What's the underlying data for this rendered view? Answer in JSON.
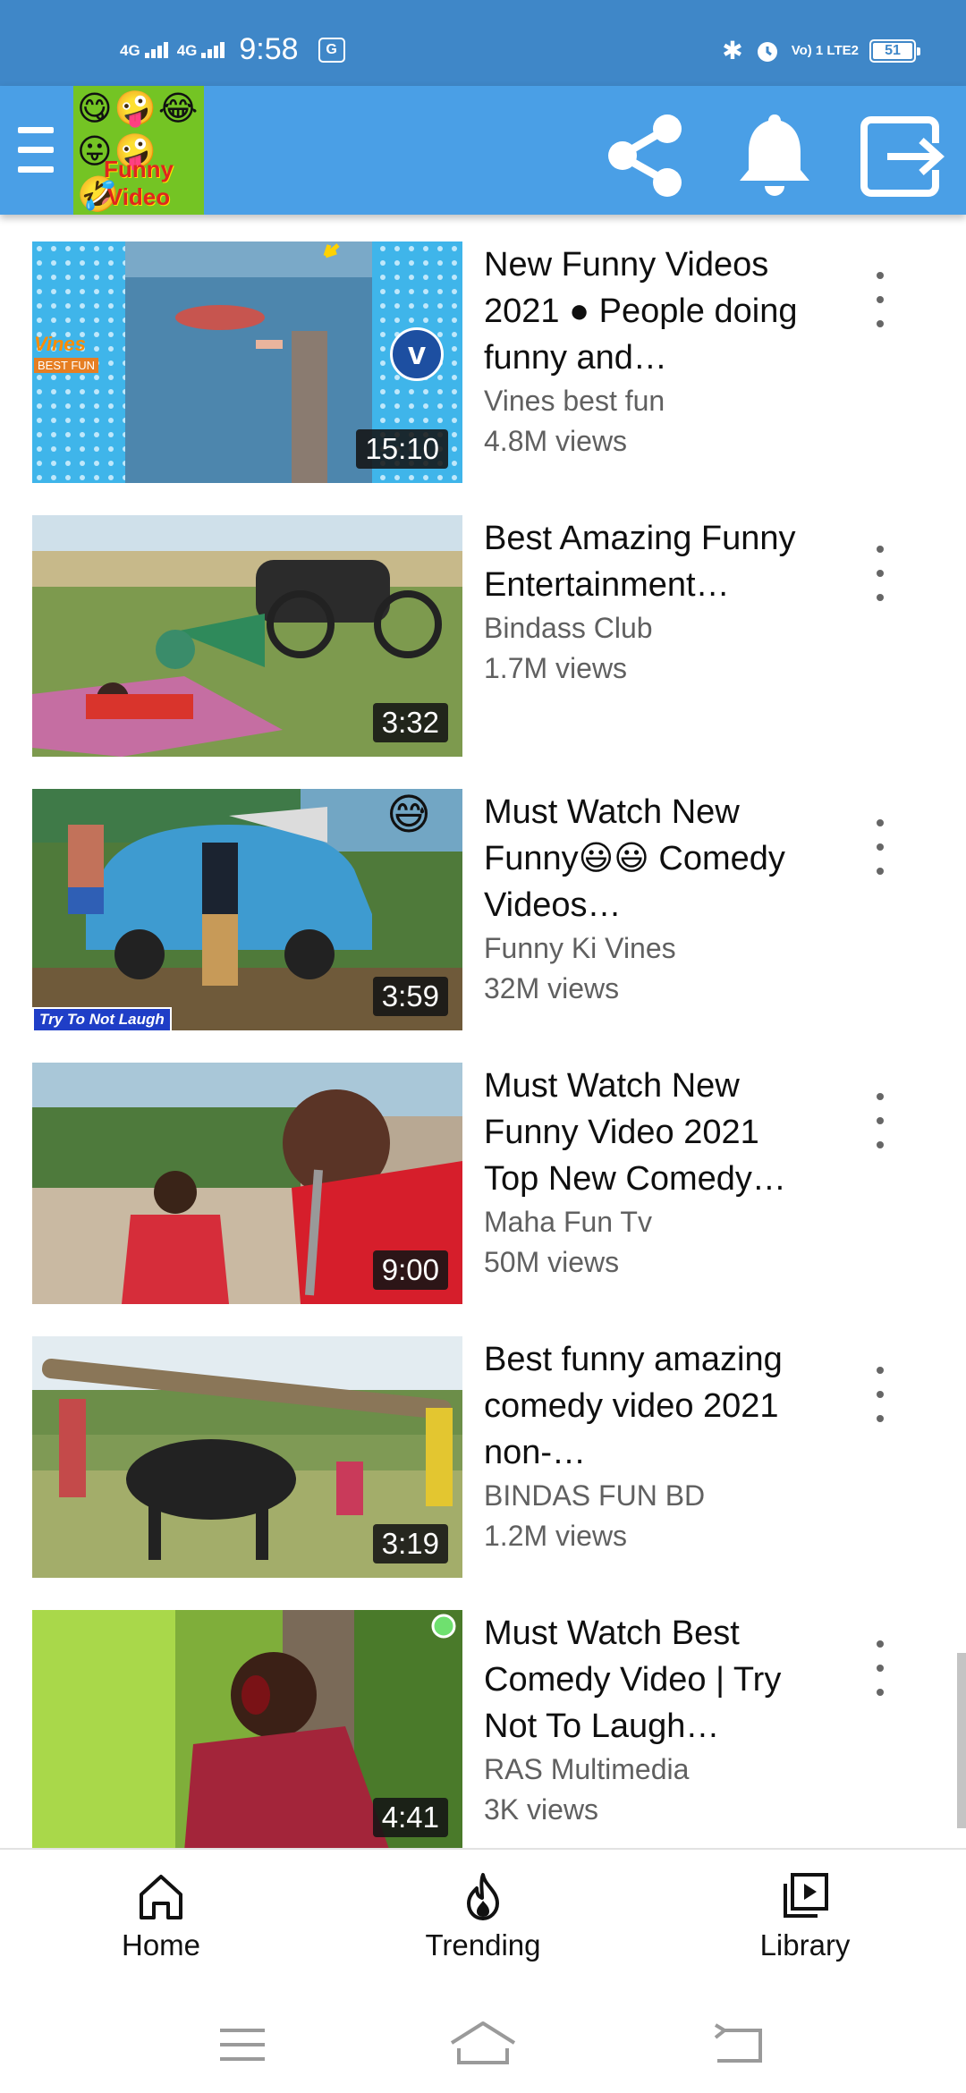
{
  "status_bar": {
    "network1": "4G",
    "network2": "4G",
    "time": "9:58",
    "notification_icon": "translate-icon",
    "volte": "Vo) 1 LTE2",
    "battery": "51"
  },
  "app_bar": {
    "menu_icon": "hamburger-menu-icon",
    "logo_text": "Funny Video",
    "logo_emojis": "😋🤪😂😛🤪🤣",
    "share_icon": "share-icon",
    "bell_icon": "bell-icon",
    "exit_icon": "exit-icon"
  },
  "videos": [
    {
      "title": "New Funny Videos 2021 ● People doing funny and…",
      "channel": "Vines best fun",
      "views": "4.8M views",
      "duration": "15:10",
      "thumb_text": "Vines",
      "thumb_subtext": "BEST FUN",
      "badge": "v"
    },
    {
      "title": "Best Amazing Funny Entertainment…",
      "channel": "Bindass Club",
      "views": "1.7M views",
      "duration": "3:32"
    },
    {
      "title": "Must Watch New Funny😃😃 Comedy Videos…",
      "channel": "Funny Ki Vines",
      "views": "32M views",
      "duration": "3:59",
      "thumb_text": "Try To Not Laugh",
      "thumb_emoji": "😅"
    },
    {
      "title": "Must Watch New Funny Video 2021 Top New Comedy…",
      "channel": "Maha Fun Tv",
      "views": "50M views",
      "duration": "9:00"
    },
    {
      "title": "Best funny amazing comedy video 2021 non-…",
      "channel": "BINDAS FUN BD",
      "views": "1.2M views",
      "duration": "3:19"
    },
    {
      "title": "Must Watch Best Comedy Video | Try Not To Laugh…",
      "channel": "RAS Multimedia",
      "views": "3K views",
      "duration": "4:41"
    }
  ],
  "bottom_nav": [
    {
      "label": "Home",
      "icon": "home-icon"
    },
    {
      "label": "Trending",
      "icon": "fire-icon"
    },
    {
      "label": "Library",
      "icon": "library-icon"
    }
  ],
  "system_nav": {
    "menu": "recents-icon",
    "home": "system-home-icon",
    "back": "back-icon"
  }
}
